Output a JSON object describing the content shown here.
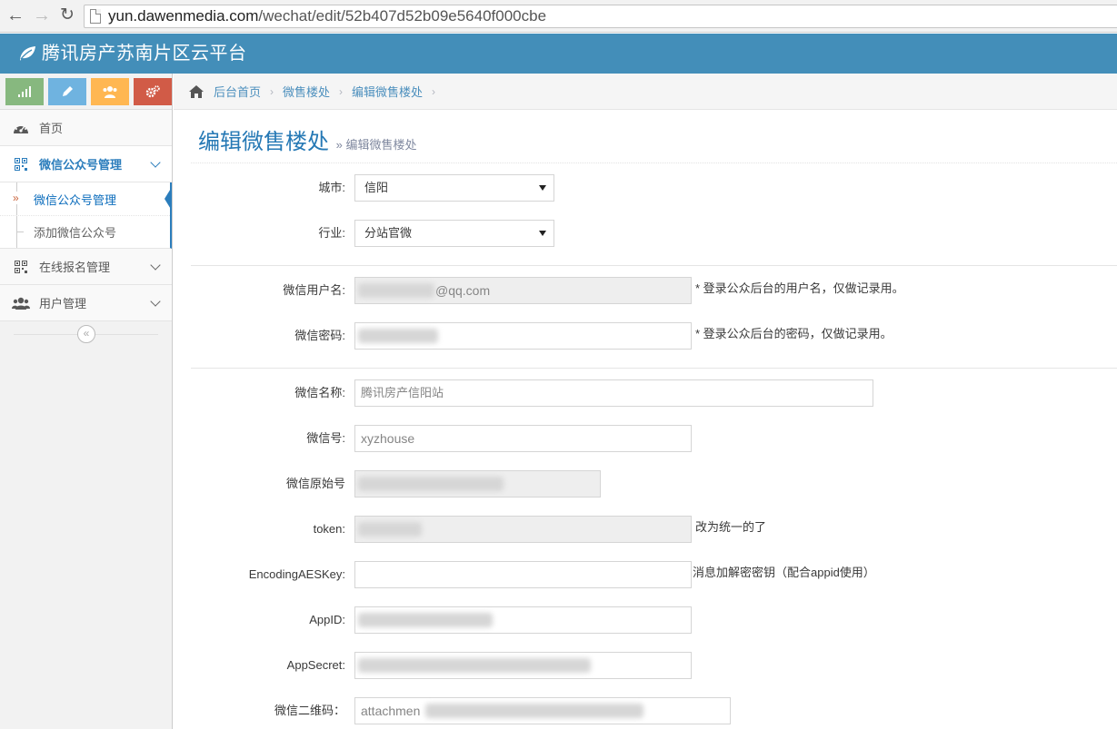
{
  "browser": {
    "back_icon": "arrow-left-icon",
    "forward_icon": "arrow-right-icon",
    "reload_icon": "reload-icon",
    "url_host": "yun.dawenmedia.com",
    "url_path": "/wechat/edit/52b407d52b09e5640f000cbe"
  },
  "header": {
    "title": "腾讯房产苏南片区云平台",
    "logo_icon": "leaf-icon",
    "color": "#438eb9"
  },
  "shortcuts": [
    {
      "icon": "signal-icon",
      "color": "#87b87f"
    },
    {
      "icon": "pencil-icon",
      "color": "#6fb3e0"
    },
    {
      "icon": "users-icon",
      "color": "#ffb752"
    },
    {
      "icon": "cogs-icon",
      "color": "#d15b47"
    }
  ],
  "sidebar": {
    "home": "首页",
    "wechat_manage": "微信公众号管理",
    "wechat_sub": [
      "微信公众号管理",
      "添加微信公众号"
    ],
    "signup_manage": "在线报名管理",
    "user_manage": "用户管理",
    "collapse_icon": "double-angle-left-icon"
  },
  "breadcrumb": [
    "后台首页",
    "微售楼处",
    "编辑微售楼处"
  ],
  "page": {
    "title": "编辑微售楼处",
    "subtitle": "» 编辑微售楼处"
  },
  "form": {
    "city_label": "城市:",
    "city_value": "信阳",
    "industry_label": "行业:",
    "industry_value": "分站官微",
    "username_label": "微信用户名:",
    "username_value": "@qq.com",
    "username_hint": "* 登录公众后台的用户名，仅做记录用。",
    "password_label": "微信密码:",
    "password_hint": "* 登录公众后台的密码，仅做记录用。",
    "name_label": "微信名称:",
    "name_value": "腾讯房产信阳站",
    "wxid_label": "微信号:",
    "wxid_value": "xyzhouse",
    "origin_label": "微信原始号",
    "token_label": "token:",
    "token_hint": "改为统一的了",
    "aeskey_label": "EncodingAESKey:",
    "aeskey_hint": "消息加解密密钥（配合appid使用）",
    "appid_label": "AppID:",
    "appsecret_label": "AppSecret:",
    "qrcode_label": "微信二维码：",
    "qrcode_value": "attachmen"
  }
}
